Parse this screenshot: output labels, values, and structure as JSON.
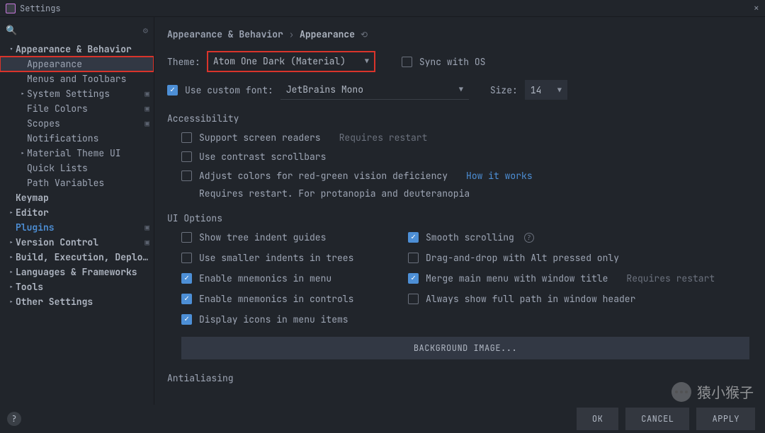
{
  "window": {
    "title": "Settings"
  },
  "search": {
    "placeholder": ""
  },
  "sidebar": {
    "items": [
      {
        "label": "Appearance & Behavior",
        "indent": 0,
        "caret": "v",
        "bold": true
      },
      {
        "label": "Appearance",
        "indent": 1,
        "caret": "",
        "selected": true,
        "highlight": true
      },
      {
        "label": "Menus and Toolbars",
        "indent": 1,
        "caret": ""
      },
      {
        "label": "System Settings",
        "indent": 1,
        "caret": ">",
        "badge": true
      },
      {
        "label": "File Colors",
        "indent": 1,
        "caret": "",
        "badge": true
      },
      {
        "label": "Scopes",
        "indent": 1,
        "caret": "",
        "badge": true
      },
      {
        "label": "Notifications",
        "indent": 1,
        "caret": ""
      },
      {
        "label": "Material Theme UI",
        "indent": 1,
        "caret": ">"
      },
      {
        "label": "Quick Lists",
        "indent": 1,
        "caret": ""
      },
      {
        "label": "Path Variables",
        "indent": 1,
        "caret": ""
      },
      {
        "label": "Keymap",
        "indent": 0,
        "caret": "",
        "bold": true
      },
      {
        "label": "Editor",
        "indent": 0,
        "caret": ">",
        "bold": true
      },
      {
        "label": "Plugins",
        "indent": 0,
        "caret": "",
        "bold": true,
        "blue": true,
        "badge": true
      },
      {
        "label": "Version Control",
        "indent": 0,
        "caret": ">",
        "bold": true,
        "badge": true
      },
      {
        "label": "Build, Execution, Deployment",
        "indent": 0,
        "caret": ">",
        "bold": true
      },
      {
        "label": "Languages & Frameworks",
        "indent": 0,
        "caret": ">",
        "bold": true
      },
      {
        "label": "Tools",
        "indent": 0,
        "caret": ">",
        "bold": true
      },
      {
        "label": "Other Settings",
        "indent": 0,
        "caret": ">",
        "bold": true
      }
    ]
  },
  "breadcrumb": {
    "parent": "Appearance & Behavior",
    "current": "Appearance"
  },
  "theme": {
    "label": "Theme:",
    "value": "Atom One Dark (Material)",
    "sync_label": "Sync with OS",
    "sync_checked": false
  },
  "font": {
    "checkbox_label": "Use custom font:",
    "checked": true,
    "value": "JetBrains Mono",
    "size_label": "Size:",
    "size_value": "14"
  },
  "accessibility": {
    "title": "Accessibility",
    "items": [
      {
        "label": "Support screen readers",
        "checked": false,
        "suffix": "Requires restart"
      },
      {
        "label": "Use contrast scrollbars",
        "checked": false
      },
      {
        "label": "Adjust colors for red-green vision deficiency",
        "checked": false,
        "link": "How it works"
      }
    ],
    "note": "Requires restart. For protanopia and deuteranopia"
  },
  "ui_options": {
    "title": "UI Options",
    "left": [
      {
        "label": "Show tree indent guides",
        "checked": false
      },
      {
        "label": "Use smaller indents in trees",
        "checked": false
      },
      {
        "label": "Enable mnemonics in menu",
        "checked": true
      },
      {
        "label": "Enable mnemonics in controls",
        "checked": true
      },
      {
        "label": "Display icons in menu items",
        "checked": true
      }
    ],
    "right": [
      {
        "label": "Smooth scrolling",
        "checked": true,
        "info": true
      },
      {
        "label": "Drag-and-drop with Alt pressed only",
        "checked": false
      },
      {
        "label": "Merge main menu with window title",
        "checked": true,
        "suffix": "Requires restart"
      },
      {
        "label": "Always show full path in window header",
        "checked": false
      }
    ],
    "bg_button": "BACKGROUND IMAGE..."
  },
  "antialiasing": {
    "title": "Antialiasing"
  },
  "footer": {
    "ok": "OK",
    "cancel": "CANCEL",
    "apply": "APPLY"
  },
  "watermark": {
    "text": "猿小猴子"
  }
}
